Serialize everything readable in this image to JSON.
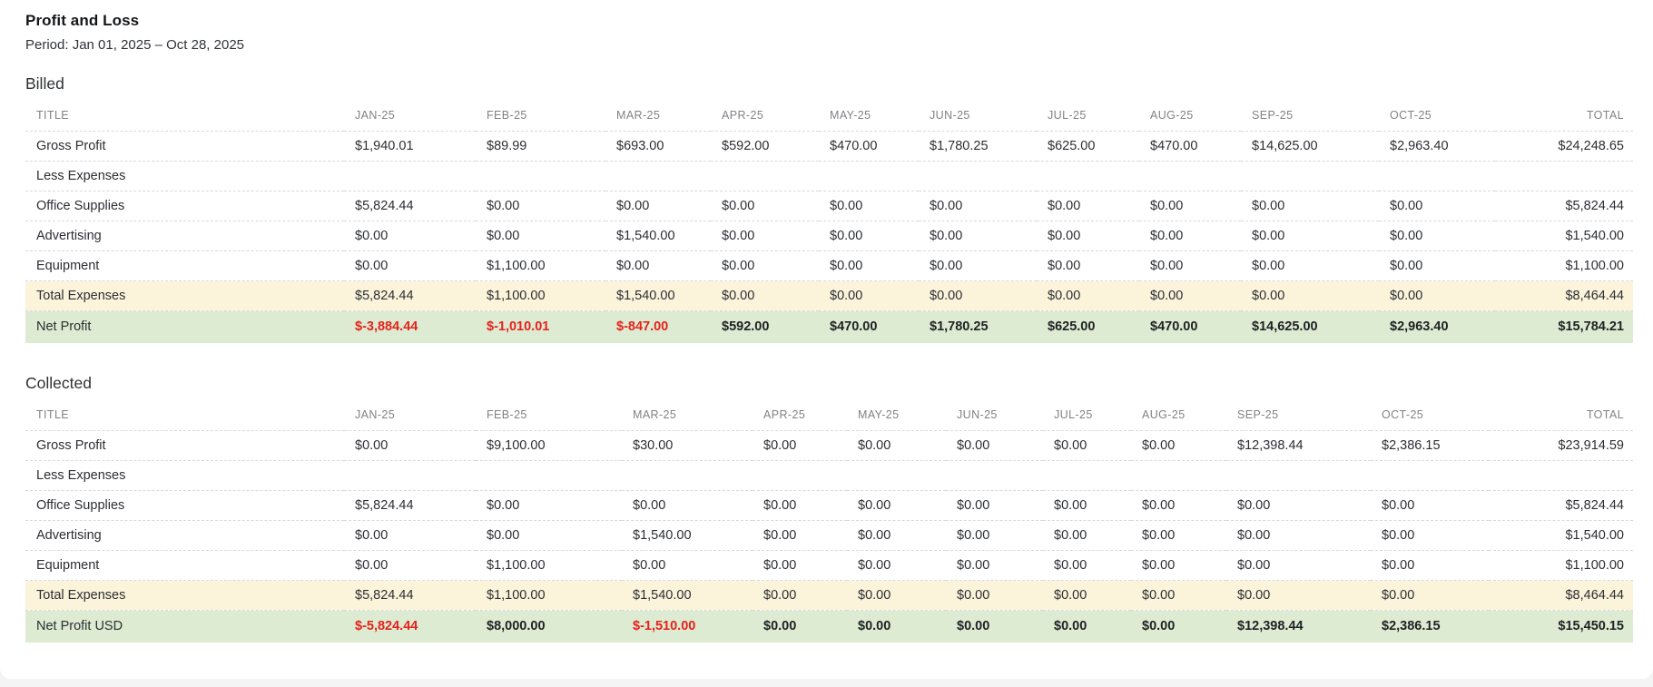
{
  "page": {
    "title": "Profit and Loss",
    "period": "Period: Jan 01, 2025 – Oct 28, 2025"
  },
  "colors": {
    "subtotal_row_bg": "#fbf3da",
    "total_row_bg": "#dcebd1",
    "negative_text": "#e7211c"
  },
  "sections": [
    {
      "heading": "Billed",
      "columns": [
        "TITLE",
        "JAN-25",
        "FEB-25",
        "MAR-25",
        "APR-25",
        "MAY-25",
        "JUN-25",
        "JUL-25",
        "AUG-25",
        "SEP-25",
        "OCT-25",
        "TOTAL"
      ],
      "rows": [
        {
          "title": "Gross Profit",
          "type": "normal",
          "values": [
            "$1,940.01",
            "$89.99",
            "$693.00",
            "$592.00",
            "$470.00",
            "$1,780.25",
            "$625.00",
            "$470.00",
            "$14,625.00",
            "$2,963.40"
          ],
          "total": "$24,248.65"
        },
        {
          "title": "Less Expenses",
          "type": "label",
          "values": [],
          "total": ""
        },
        {
          "title": "Office Supplies",
          "type": "normal",
          "values": [
            "$5,824.44",
            "$0.00",
            "$0.00",
            "$0.00",
            "$0.00",
            "$0.00",
            "$0.00",
            "$0.00",
            "$0.00",
            "$0.00"
          ],
          "total": "$5,824.44"
        },
        {
          "title": "Advertising",
          "type": "normal",
          "values": [
            "$0.00",
            "$0.00",
            "$1,540.00",
            "$0.00",
            "$0.00",
            "$0.00",
            "$0.00",
            "$0.00",
            "$0.00",
            "$0.00"
          ],
          "total": "$1,540.00"
        },
        {
          "title": "Equipment",
          "type": "normal",
          "values": [
            "$0.00",
            "$1,100.00",
            "$0.00",
            "$0.00",
            "$0.00",
            "$0.00",
            "$0.00",
            "$0.00",
            "$0.00",
            "$0.00"
          ],
          "total": "$1,100.00"
        },
        {
          "title": "Total Expenses",
          "type": "subtotal",
          "values": [
            "$5,824.44",
            "$1,100.00",
            "$1,540.00",
            "$0.00",
            "$0.00",
            "$0.00",
            "$0.00",
            "$0.00",
            "$0.00",
            "$0.00"
          ],
          "total": "$8,464.44"
        },
        {
          "title": "Net Profit",
          "type": "total",
          "values": [
            "$-3,884.44",
            "$-1,010.01",
            "$-847.00",
            "$592.00",
            "$470.00",
            "$1,780.25",
            "$625.00",
            "$470.00",
            "$14,625.00",
            "$2,963.40"
          ],
          "total": "$15,784.21"
        }
      ]
    },
    {
      "heading": "Collected",
      "columns": [
        "TITLE",
        "JAN-25",
        "FEB-25",
        "MAR-25",
        "APR-25",
        "MAY-25",
        "JUN-25",
        "JUL-25",
        "AUG-25",
        "SEP-25",
        "OCT-25",
        "TOTAL"
      ],
      "rows": [
        {
          "title": "Gross Profit",
          "type": "normal",
          "values": [
            "$0.00",
            "$9,100.00",
            "$30.00",
            "$0.00",
            "$0.00",
            "$0.00",
            "$0.00",
            "$0.00",
            "$12,398.44",
            "$2,386.15"
          ],
          "total": "$23,914.59"
        },
        {
          "title": "Less Expenses",
          "type": "label",
          "values": [],
          "total": ""
        },
        {
          "title": "Office Supplies",
          "type": "normal",
          "values": [
            "$5,824.44",
            "$0.00",
            "$0.00",
            "$0.00",
            "$0.00",
            "$0.00",
            "$0.00",
            "$0.00",
            "$0.00",
            "$0.00"
          ],
          "total": "$5,824.44"
        },
        {
          "title": "Advertising",
          "type": "normal",
          "values": [
            "$0.00",
            "$0.00",
            "$1,540.00",
            "$0.00",
            "$0.00",
            "$0.00",
            "$0.00",
            "$0.00",
            "$0.00",
            "$0.00"
          ],
          "total": "$1,540.00"
        },
        {
          "title": "Equipment",
          "type": "normal",
          "values": [
            "$0.00",
            "$1,100.00",
            "$0.00",
            "$0.00",
            "$0.00",
            "$0.00",
            "$0.00",
            "$0.00",
            "$0.00",
            "$0.00"
          ],
          "total": "$1,100.00"
        },
        {
          "title": "Total Expenses",
          "type": "subtotal",
          "values": [
            "$5,824.44",
            "$1,100.00",
            "$1,540.00",
            "$0.00",
            "$0.00",
            "$0.00",
            "$0.00",
            "$0.00",
            "$0.00",
            "$0.00"
          ],
          "total": "$8,464.44"
        },
        {
          "title": "Net Profit USD",
          "type": "total",
          "values": [
            "$-5,824.44",
            "$8,000.00",
            "$-1,510.00",
            "$0.00",
            "$0.00",
            "$0.00",
            "$0.00",
            "$0.00",
            "$12,398.44",
            "$2,386.15"
          ],
          "total": "$15,450.15"
        }
      ]
    }
  ]
}
